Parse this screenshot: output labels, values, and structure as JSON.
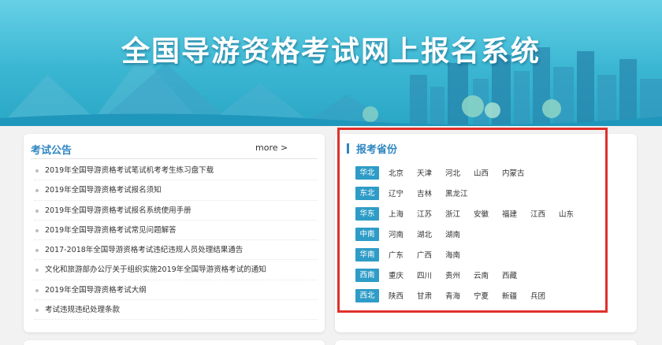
{
  "colors": {
    "accent": "#2e86c1",
    "region_tag": "#2e9cc7",
    "highlight": "#e0302b",
    "banner": "#3ab6d2"
  },
  "banner": {
    "title": "全国导游资格考试网上报名系统"
  },
  "notices": {
    "title": "考试公告",
    "more": "more >",
    "items": [
      "2019年全国导游资格考试笔试机考考生练习盘下载",
      "2019年全国导游资格考试报名须知",
      "2019年全国导游资格考试报名系统使用手册",
      "2019年全国导游资格考试常见问题解答",
      "2017-2018年全国导游资格考试违纪违规人员处理结果通告",
      "文化和旅游部办公厅关于组织实施2019年全国导游资格考试的通知",
      "2019年全国导游资格考试大纲",
      "考试违规违纪处理条款"
    ]
  },
  "provinces": {
    "title": "报考省份",
    "regions": [
      {
        "name": "华北",
        "provinces": [
          "北京",
          "天津",
          "河北",
          "山西",
          "内蒙古"
        ]
      },
      {
        "name": "东北",
        "provinces": [
          "辽宁",
          "吉林",
          "黑龙江"
        ]
      },
      {
        "name": "华东",
        "provinces": [
          "上海",
          "江苏",
          "浙江",
          "安徽",
          "福建",
          "江西",
          "山东"
        ]
      },
      {
        "name": "中南",
        "provinces": [
          "河南",
          "湖北",
          "湖南"
        ]
      },
      {
        "name": "华南",
        "provinces": [
          "广东",
          "广西",
          "海南"
        ]
      },
      {
        "name": "西南",
        "provinces": [
          "重庆",
          "四川",
          "贵州",
          "云南",
          "西藏"
        ]
      },
      {
        "name": "西北",
        "provinces": [
          "陕西",
          "甘肃",
          "青海",
          "宁夏",
          "新疆",
          "兵团"
        ]
      }
    ]
  }
}
